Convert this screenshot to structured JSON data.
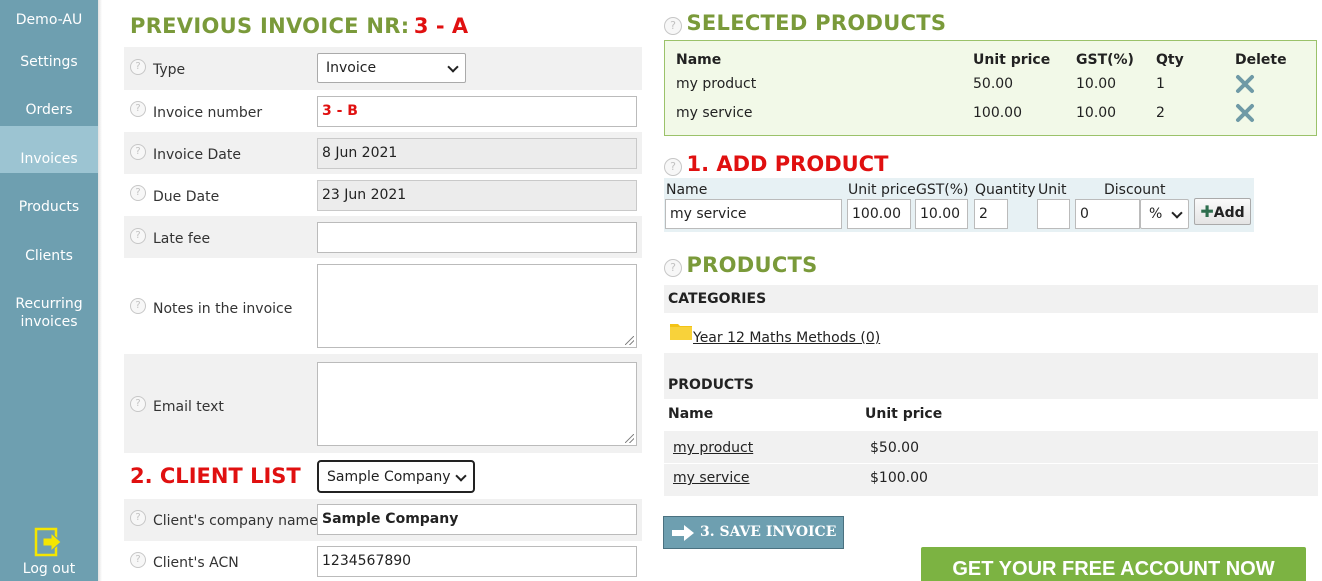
{
  "sidebar": {
    "items": [
      {
        "label": "Demo-AU"
      },
      {
        "label": "Settings"
      },
      {
        "label": "Orders"
      },
      {
        "label": "Invoices"
      },
      {
        "label": "Products"
      },
      {
        "label": "Clients"
      },
      {
        "label": "Recurring invoices"
      }
    ],
    "logout_label": "Log out"
  },
  "invoice": {
    "prev_label": "PREVIOUS INVOICE NR:",
    "prev_value": "3 - A",
    "fields": {
      "type_label": "Type",
      "type_value": "Invoice",
      "number_label": "Invoice number",
      "number_value": "3 - B",
      "date_label": "Invoice Date",
      "date_value": "8 Jun 2021",
      "due_label": "Due Date",
      "due_value": "23 Jun 2021",
      "latefee_label": "Late fee",
      "latefee_value": "",
      "notes_label": "Notes in the invoice",
      "notes_value": "",
      "email_label": "Email text",
      "email_value": ""
    }
  },
  "client": {
    "title": "2. CLIENT LIST",
    "select_value": "Sample Company",
    "company_label": "Client's company name",
    "company_value": "Sample Company",
    "acn_label": "Client's ACN",
    "acn_value": "1234567890"
  },
  "selected": {
    "title": "SELECTED PRODUCTS",
    "headers": {
      "name": "Name",
      "unit_price": "Unit price",
      "gst": "GST(%)",
      "qty": "Qty",
      "delete": "Delete"
    },
    "rows": [
      {
        "name": "my product",
        "unit_price": "50.00",
        "gst": "10.00",
        "qty": "1"
      },
      {
        "name": "my service",
        "unit_price": "100.00",
        "gst": "10.00",
        "qty": "2"
      }
    ]
  },
  "add": {
    "title": "1. ADD PRODUCT",
    "labels": {
      "name": "Name",
      "unit_price": "Unit price",
      "gst": "GST(%)",
      "quantity": "Quantity",
      "unit": "Unit",
      "discount": "Discount"
    },
    "values": {
      "name": "my service",
      "unit_price": "100.00",
      "gst": "10.00",
      "quantity": "2",
      "unit": "",
      "discount": "0",
      "discount_type": "%"
    },
    "button": "Add"
  },
  "products": {
    "title": "PRODUCTS",
    "categories_label": "CATEGORIES",
    "category_link": "Year 12 Maths Methods (0)",
    "products_label": "PRODUCTS",
    "headers": {
      "name": "Name",
      "unit_price": "Unit price"
    },
    "rows": [
      {
        "name": "my product",
        "price": "$50.00"
      },
      {
        "name": "my service",
        "price": "$100.00"
      }
    ]
  },
  "actions": {
    "save": "3. SAVE INVOICE",
    "free_account": "GET YOUR FREE ACCOUNT NOW"
  },
  "colors": {
    "sidebar": "#6e9fb0",
    "sidebar_active": "#9cc4d2",
    "heading_green": "#7a9a3a",
    "heading_red": "#e01010",
    "cta_green": "#7cb342"
  }
}
